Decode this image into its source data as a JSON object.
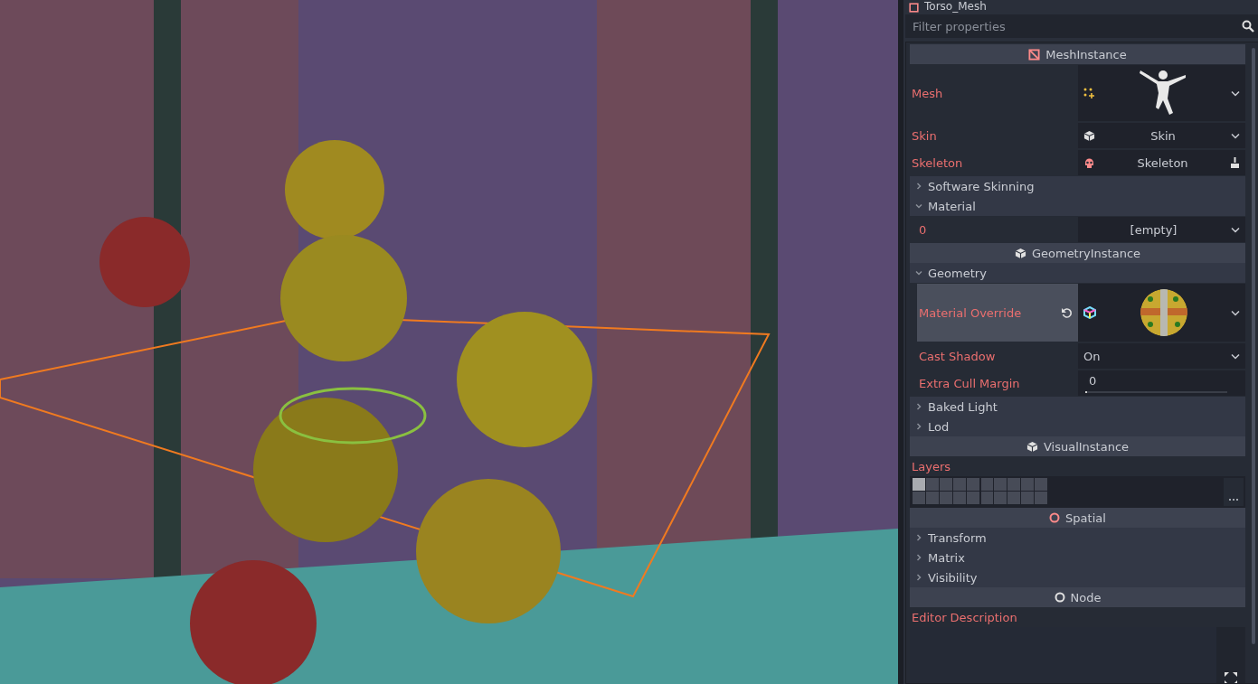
{
  "node": {
    "name": "Torso_Mesh"
  },
  "filter": {
    "placeholder": "Filter properties"
  },
  "sections": [
    {
      "kind": "category",
      "label": "MeshInstance"
    },
    {
      "kind": "property",
      "label": "Mesh",
      "modified": false,
      "editor": {
        "kind": "preview"
      }
    },
    {
      "kind": "property",
      "label": "Skin",
      "modified": false,
      "editor": {
        "kind": "resource",
        "value": "Skin"
      }
    },
    {
      "kind": "property",
      "label": "Skeleton",
      "modified": false,
      "editor": {
        "kind": "node",
        "value": "Skeleton"
      }
    },
    {
      "kind": "group",
      "label": "Software Skinning",
      "expanded": false
    },
    {
      "kind": "group",
      "label": "Material",
      "expanded": true,
      "children": [
        {
          "kind": "property",
          "label": "0",
          "modified": false,
          "editor": {
            "kind": "empty",
            "value": "[empty]"
          }
        }
      ]
    },
    {
      "kind": "category",
      "label": "GeometryInstance"
    },
    {
      "kind": "group",
      "label": "Geometry",
      "expanded": true,
      "children": [
        {
          "kind": "property",
          "label": "Material Override",
          "modified": true,
          "editor": {
            "kind": "material"
          }
        },
        {
          "kind": "property",
          "label": "Cast Shadow",
          "modified": false,
          "editor": {
            "kind": "enum",
            "value": "On"
          }
        },
        {
          "kind": "property",
          "label": "Extra Cull Margin",
          "modified": false,
          "editor": {
            "kind": "number",
            "value": "0",
            "level": 0.01
          }
        }
      ]
    },
    {
      "kind": "group",
      "label": "Baked Light",
      "expanded": false
    },
    {
      "kind": "group",
      "label": "Lod",
      "expanded": false
    },
    {
      "kind": "category",
      "label": "VisualInstance"
    },
    {
      "kind": "property",
      "label": "Layers",
      "editor": {
        "kind": "layers",
        "cells": [
          {
            "on": true
          },
          {
            "on": false
          },
          {
            "on": false
          },
          {
            "on": false
          },
          {
            "on": false
          },
          {
            "on": false
          },
          {
            "on": false
          },
          {
            "on": false
          },
          {
            "on": false
          },
          {
            "on": false
          },
          {
            "on": false
          },
          {
            "on": false
          },
          {
            "on": false
          },
          {
            "on": false
          },
          {
            "on": false
          },
          {
            "on": false
          },
          {
            "on": false
          },
          {
            "on": false
          },
          {
            "on": false
          },
          {
            "on": false
          }
        ]
      }
    },
    {
      "kind": "category",
      "label": "Spatial"
    },
    {
      "kind": "group",
      "label": "Transform",
      "expanded": false
    },
    {
      "kind": "group",
      "label": "Matrix",
      "expanded": false
    },
    {
      "kind": "group",
      "label": "Visibility",
      "expanded": false
    },
    {
      "kind": "category",
      "label": "Node"
    },
    {
      "kind": "property",
      "label": "Editor Description",
      "editor": {
        "kind": "text"
      }
    }
  ]
}
